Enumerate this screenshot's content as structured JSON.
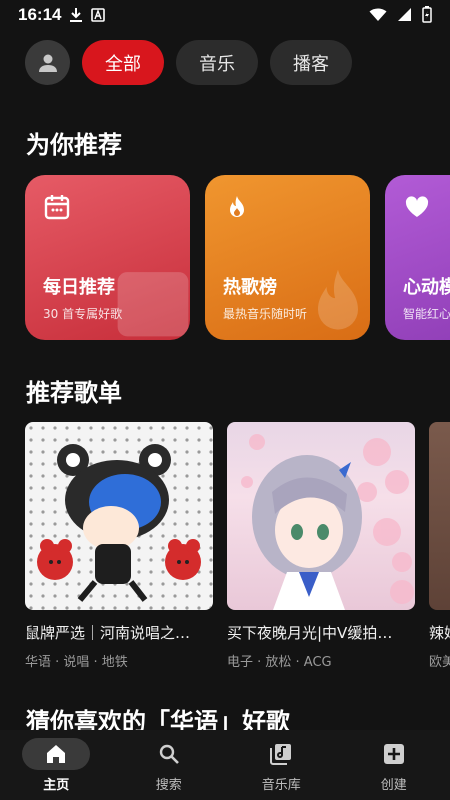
{
  "status_bar": {
    "time": "16:14"
  },
  "chips": [
    {
      "label": "全部"
    },
    {
      "label": "音乐"
    },
    {
      "label": "播客"
    }
  ],
  "section_recommend": {
    "title": "为你推荐"
  },
  "rec_cards": [
    {
      "title": "每日推荐",
      "subtitle": "30 首专属好歌",
      "icon": "calendar-icon",
      "color": "#d8414f"
    },
    {
      "title": "热歌榜",
      "subtitle": "最热音乐随时听",
      "icon": "flame-icon",
      "color": "#e07c22"
    },
    {
      "title": "心动模式",
      "subtitle": "智能红心",
      "icon": "heart-icon",
      "color": "#a54bc7"
    }
  ],
  "section_playlists": {
    "title": "推荐歌单"
  },
  "playlists": [
    {
      "name": "鼠牌严选｜河南说唱之…",
      "tags": "华语 · 说唱 · 地铁"
    },
    {
      "name": "买下夜晚月光|中V缓拍…",
      "tags": "电子 · 放松 · ACG"
    },
    {
      "name": "辣妹",
      "tags": "欧美"
    }
  ],
  "section_guess": {
    "title": "猜你喜欢的「华语」好歌"
  },
  "tabs": [
    {
      "label": "主页",
      "icon": "home-icon"
    },
    {
      "label": "搜索",
      "icon": "search-icon"
    },
    {
      "label": "音乐库",
      "icon": "library-icon"
    },
    {
      "label": "创建",
      "icon": "add-box-icon"
    }
  ]
}
